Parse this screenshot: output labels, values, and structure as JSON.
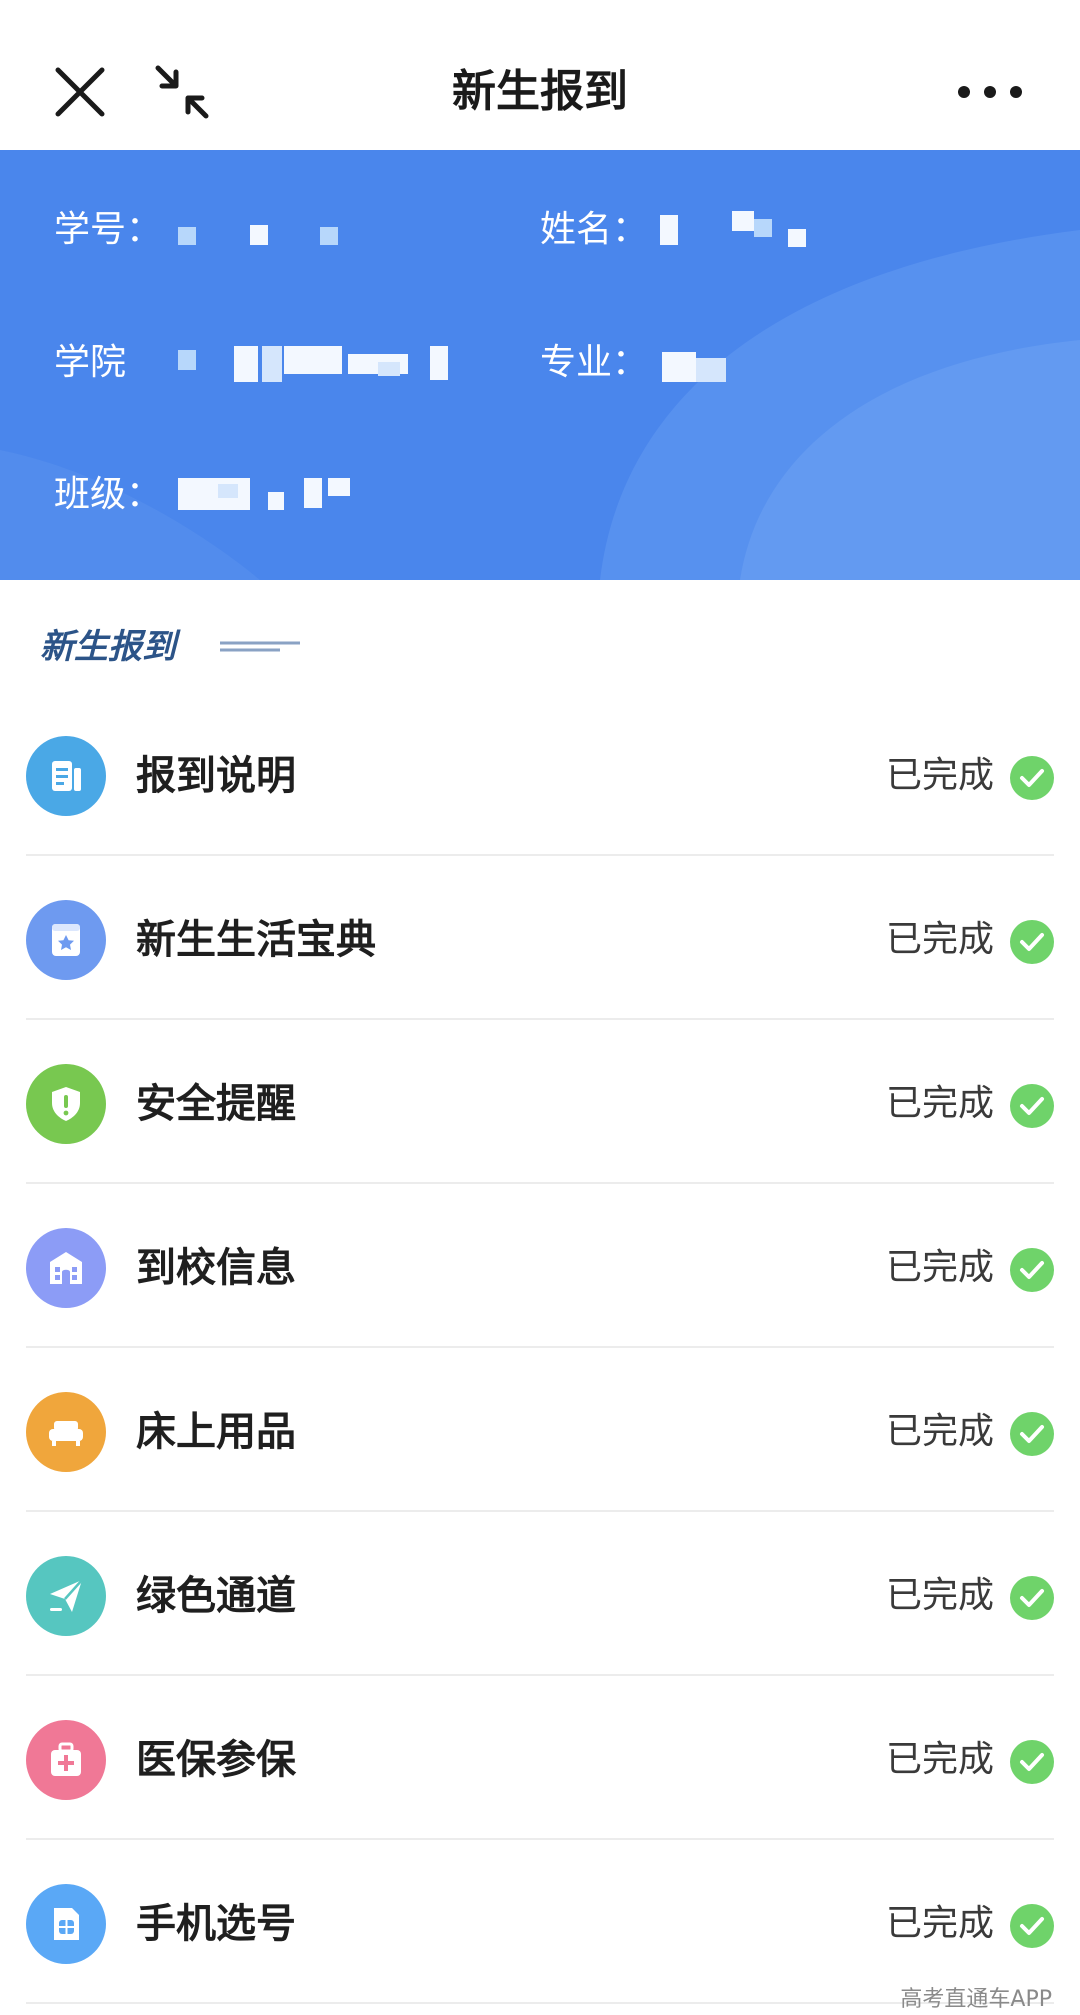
{
  "topbar": {
    "title": "新生报到",
    "icons": {
      "close": "close-icon",
      "minimize": "minimize-icon",
      "more": "more-icon"
    }
  },
  "info": {
    "student_id_label": "学号：",
    "name_label": "姓名：",
    "college_label": "学院",
    "major_label": "专业：",
    "class_label": "班级："
  },
  "section": {
    "title": "新生报到"
  },
  "items": [
    {
      "label": "报到说明",
      "status": "已完成",
      "icon": "document-icon",
      "color": "#4aa8e6"
    },
    {
      "label": "新生生活宝典",
      "status": "已完成",
      "icon": "guidebook-icon",
      "color": "#6e9af0"
    },
    {
      "label": "安全提醒",
      "status": "已完成",
      "icon": "shield-icon",
      "color": "#78c850"
    },
    {
      "label": "到校信息",
      "status": "已完成",
      "icon": "school-building-icon",
      "color": "#8c9cf6"
    },
    {
      "label": "床上用品",
      "status": "已完成",
      "icon": "bed-icon",
      "color": "#f0a63c"
    },
    {
      "label": "绿色通道",
      "status": "已完成",
      "icon": "paper-plane-icon",
      "color": "#56c6c0"
    },
    {
      "label": "医保参保",
      "status": "已完成",
      "icon": "medical-kit-icon",
      "color": "#f07896"
    },
    {
      "label": "手机选号",
      "status": "已完成",
      "icon": "sim-card-icon",
      "color": "#5aa8f6"
    }
  ],
  "colors": {
    "header_blue": "#4a86ec",
    "check_green": "#6fd36a"
  },
  "watermark": "高考直通车APP"
}
